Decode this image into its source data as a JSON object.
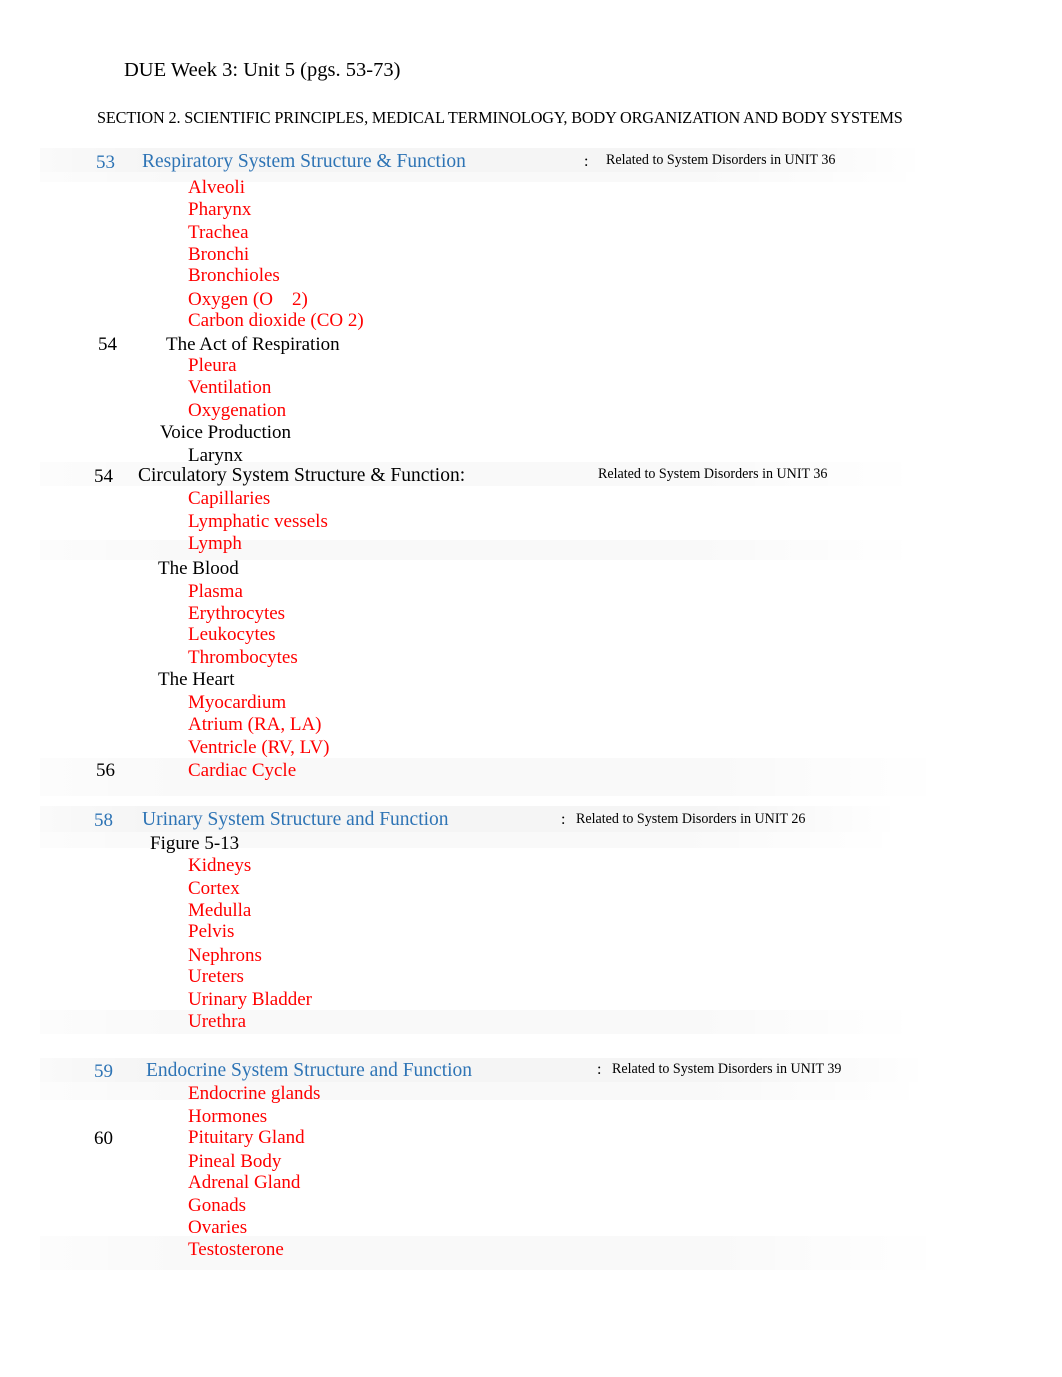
{
  "document": {
    "title": "DUE Week 3: Unit 5 (pgs. 53-73)",
    "section_heading": "SECTION 2. SCIENTIFIC PRINCIPLES, MEDICAL TERMINOLOGY, BODY ORGANIZATION AND BODY SYSTEMS"
  },
  "colors": {
    "heading_blue": "#2E74B5",
    "item_red": "#FF0000",
    "body_black": "#000000",
    "page_background": "#FFFFFF",
    "shading_band": "rgba(0,0,0,0.04)"
  },
  "annotations": {
    "colon": ":",
    "respiratory": "Related to System Disorders in UNIT 36",
    "circulatory": "Related to System Disorders in UNIT 36",
    "urinary": "Related to System Disorders in UNIT 26",
    "endocrine": "Related to System Disorders in UNIT 39"
  },
  "outline": {
    "respiratory": {
      "page": "53",
      "heading": "Respiratory System Structure & Function",
      "items": [
        "Alveoli",
        "Pharynx",
        "Trachea",
        "Bronchi",
        "Bronchioles",
        "Oxygen (O    2)",
        "Carbon dioxide (CO 2)"
      ],
      "act_of_respiration": {
        "page": "54",
        "heading": "The Act of Respiration",
        "items": [
          "Pleura",
          "Ventilation",
          "Oxygenation"
        ]
      },
      "voice_production": {
        "heading": "Voice Production",
        "items": [
          "Larynx"
        ]
      }
    },
    "circulatory": {
      "page": "54",
      "heading": "Circulatory System Structure & Function:",
      "items": [
        "Capillaries",
        "Lymphatic vessels",
        "Lymph"
      ],
      "the_blood": {
        "heading": "The Blood",
        "items": [
          "Plasma",
          "Erythrocytes",
          "Leukocytes",
          "Thrombocytes"
        ]
      },
      "the_heart": {
        "heading": "The Heart",
        "items": [
          "Myocardium",
          "Atrium (RA, LA)",
          "Ventricle (RV, LV)"
        ]
      },
      "cardiac_cycle": {
        "page": "56",
        "label": "Cardiac Cycle"
      }
    },
    "urinary": {
      "page": "58",
      "heading": "Urinary System Structure and Function",
      "figure": "Figure 5-13",
      "items": [
        "Kidneys",
        "Cortex",
        "Medulla",
        "Pelvis",
        "Nephrons",
        "Ureters",
        "Urinary Bladder",
        "Urethra"
      ]
    },
    "endocrine": {
      "page": "59",
      "heading": "Endocrine System Structure and Function",
      "items_before": [
        "Endocrine glands",
        "Hormones"
      ],
      "page_60": "60",
      "items_after": [
        "Pituitary Gland",
        "Pineal Body",
        "Adrenal Gland",
        "Gonads",
        "Ovaries",
        "Testosterone"
      ]
    }
  }
}
